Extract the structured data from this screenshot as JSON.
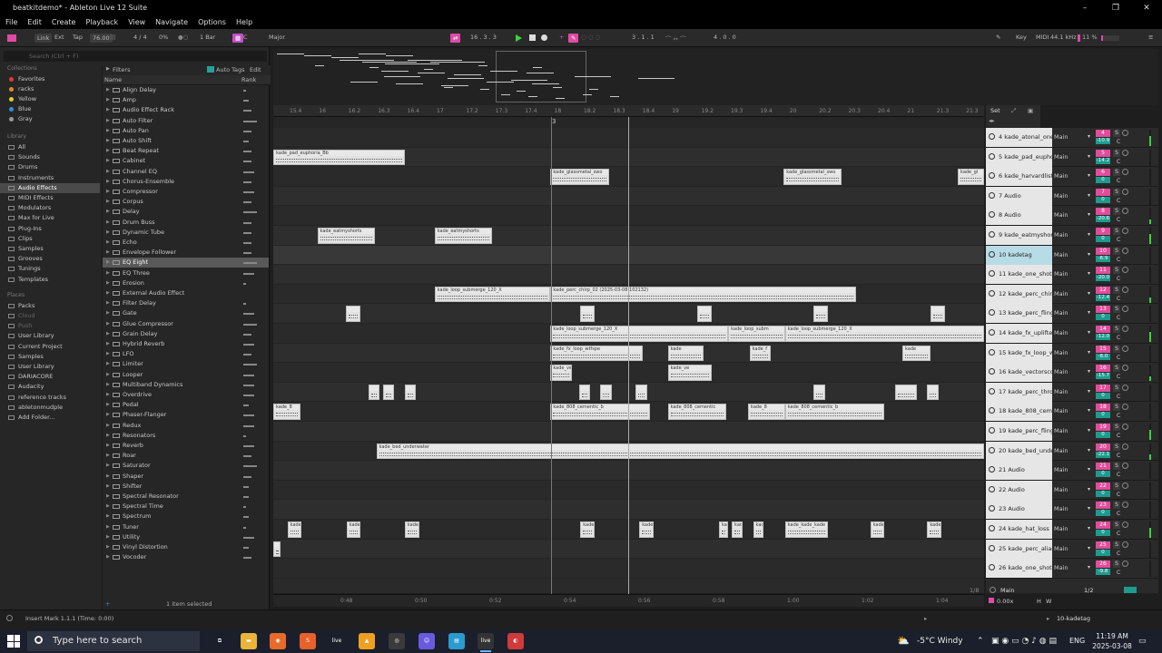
{
  "window": {
    "title": "beatkitdemo* - Ableton Live 12 Suite",
    "controls": [
      "–",
      "❐",
      "✕"
    ]
  },
  "menu": [
    "File",
    "Edit",
    "Create",
    "Playback",
    "View",
    "Navigate",
    "Options",
    "Help"
  ],
  "control_bar": {
    "link": "Link",
    "ext": "Ext",
    "tap": "Tap",
    "tempo": "76.00",
    "time_sig": "4 / 4",
    "swing": "0%",
    "quantize": "1 Bar",
    "key": "C",
    "scale": "Major",
    "position": "16 .   3 .   3",
    "loop_start": "3 .   1 .   1",
    "loop_length": "4 .   0 .   0",
    "key_map": "Key",
    "midi_map": "MIDI",
    "sample_rate": "44.1 kHz",
    "cpu": "11 %",
    "cpu_fraction": 0.11
  },
  "browser": {
    "search_placeholder": "Search (Ctrl + F)",
    "collections_label": "Collections",
    "collections": [
      {
        "label": "Favorites",
        "color": "#e03a3a"
      },
      {
        "label": "racks",
        "color": "#e08a2a"
      },
      {
        "label": "Yellow",
        "color": "#e0d02a"
      },
      {
        "label": "Blue",
        "color": "#3a8ae0"
      },
      {
        "label": "Gray",
        "color": "#9a9a9a"
      }
    ],
    "library_label": "Library",
    "library": [
      "All",
      "Sounds",
      "Drums",
      "Instruments",
      "Audio Effects",
      "MIDI Effects",
      "Modulators",
      "Max for Live",
      "Plug-Ins",
      "Clips",
      "Samples",
      "Grooves",
      "Tunings",
      "Templates"
    ],
    "library_selected": "Audio Effects",
    "places_label": "Places",
    "places": [
      "Packs",
      "Cloud",
      "Push",
      "User Library",
      "Current Project",
      "Samples",
      "User Library",
      "DARIACORE",
      "Audacity",
      "reference tracks",
      "abletonmudple",
      "Add Folder..."
    ],
    "filters": "Filters",
    "auto_tags": "Auto Tags",
    "edit": "Edit",
    "col_name": "Name",
    "col_rank": "Rank",
    "items": [
      "Align Delay",
      "Amp",
      "Audio Effect Rack",
      "Auto Filter",
      "Auto Pan",
      "Auto Shift",
      "Beat Repeat",
      "Cabinet",
      "Channel EQ",
      "Chorus-Ensemble",
      "Compressor",
      "Corpus",
      "Delay",
      "Drum Buss",
      "Dynamic Tube",
      "Echo",
      "Envelope Follower",
      "EQ Eight",
      "EQ Three",
      "Erosion",
      "External Audio Effect",
      "Filter Delay",
      "Gate",
      "Glue Compressor",
      "Grain Delay",
      "Hybrid Reverb",
      "LFO",
      "Limiter",
      "Looper",
      "Multiband Dynamics",
      "Overdrive",
      "Pedal",
      "Phaser-Flanger",
      "Redux",
      "Resonators",
      "Reverb",
      "Roar",
      "Saturator",
      "Shaper",
      "Shifter",
      "Spectral Resonator",
      "Spectral Time",
      "Spectrum",
      "Tuner",
      "Utility",
      "Vinyl Distortion",
      "Vocoder"
    ],
    "ranks": [
      1,
      2,
      3,
      5,
      3,
      2,
      3,
      3,
      4,
      3,
      4,
      3,
      5,
      3,
      3,
      3,
      3,
      5,
      4,
      1,
      0,
      1,
      4,
      5,
      3,
      4,
      3,
      5,
      4,
      4,
      4,
      2,
      4,
      4,
      1,
      4,
      3,
      5,
      3,
      2,
      2,
      1,
      2,
      1,
      4,
      2,
      3
    ],
    "selected_item": "EQ Eight",
    "footer": "1 item selected"
  },
  "ruler_ticks": [
    "15.4",
    "16",
    "16.2",
    "16.3",
    "16.4",
    "17",
    "17.2",
    "17.3",
    "17.4",
    "18",
    "18.2",
    "18.3",
    "18.4",
    "19",
    "19.2",
    "19.3",
    "19.4",
    "20",
    "20.2",
    "20.3",
    "20.4",
    "21",
    "21.3",
    "21.3"
  ],
  "bottom_ticks": [
    "0:48",
    "0:50",
    "0:52",
    "0:54",
    "0:56",
    "0:58",
    "1:00",
    "1:02",
    "1:04"
  ],
  "set_label": "Set",
  "loop_marker": "3",
  "tracks": [
    {
      "name": "4 kade_atonal_one",
      "num": "4",
      "vol": "-10.9"
    },
    {
      "name": "5 kade_pad_euphor",
      "num": "5",
      "vol": "-14.2"
    },
    {
      "name": "6 kade_harvardlist",
      "num": "6",
      "vol": "0"
    },
    {
      "name": "7 Audio",
      "num": "7",
      "vol": "0"
    },
    {
      "name": "8 Audio",
      "num": "8",
      "vol": "-20.6"
    },
    {
      "name": "9 kade_eatmyshort",
      "num": "9",
      "vol": "0"
    },
    {
      "name": "10 kadetag",
      "num": "10",
      "vol": "-6.9"
    },
    {
      "name": "11 kade_one_shot",
      "num": "11",
      "vol": "-20.0"
    },
    {
      "name": "12 kade_perc_chirp",
      "num": "12",
      "vol": "-12.4"
    },
    {
      "name": "13 kade_perc_fling",
      "num": "13",
      "vol": "0"
    },
    {
      "name": "14 kade_fx_uplifter",
      "num": "14",
      "vol": "-12.0"
    },
    {
      "name": "15 kade_fx_loop_w",
      "num": "15",
      "vol": "-6.0"
    },
    {
      "name": "16 kade_vectorsco",
      "num": "16",
      "vol": "-15.7"
    },
    {
      "name": "17 kade_perc_thro",
      "num": "17",
      "vol": "0"
    },
    {
      "name": "18 kade_808_cema",
      "num": "18",
      "vol": "0"
    },
    {
      "name": "19 kade_perc_fling",
      "num": "19",
      "vol": "0"
    },
    {
      "name": "20 kade_bed_under",
      "num": "20",
      "vol": "-22.1"
    },
    {
      "name": "21 Audio",
      "num": "21",
      "vol": "0"
    },
    {
      "name": "22 Audio",
      "num": "22",
      "vol": "0"
    },
    {
      "name": "23 Audio",
      "num": "23",
      "vol": "0"
    },
    {
      "name": "24 kade_hat_loss",
      "num": "24",
      "vol": "0"
    },
    {
      "name": "25 kade_perc_alias",
      "num": "25",
      "vol": "0"
    },
    {
      "name": "26 kade_one_shot",
      "num": "26",
      "vol": "-9.8"
    }
  ],
  "selected_track": "10 kadetag",
  "route_label": "Main",
  "clips": [
    {
      "lane": 1,
      "start": 0.0,
      "end": 0.185,
      "label": "kade_pad_euphoria_Bb"
    },
    {
      "lane": 2,
      "start": 0.39,
      "end": 0.473,
      "label": "kade_glassmetal_swo"
    },
    {
      "lane": 2,
      "start": 0.718,
      "end": 0.8,
      "label": "kade_glassmetal_swo"
    },
    {
      "lane": 2,
      "start": 0.963,
      "end": 1.0,
      "label": "kade_gl"
    },
    {
      "lane": 5,
      "start": 0.062,
      "end": 0.143,
      "label": "kade_eatmyshorts"
    },
    {
      "lane": 5,
      "start": 0.227,
      "end": 0.308,
      "label": "kade_eatmyshorts"
    },
    {
      "lane": 8,
      "start": 0.227,
      "end": 0.39,
      "label": "kade_loop_submerge_120_X"
    },
    {
      "lane": 8,
      "start": 0.39,
      "end": 0.82,
      "label": "kade_perc_chirp_02 (2025-03-08 102132)"
    },
    {
      "lane": 9,
      "start": 0.102,
      "end": 0.122,
      "label": ""
    },
    {
      "lane": 9,
      "start": 0.432,
      "end": 0.452,
      "label": ""
    },
    {
      "lane": 9,
      "start": 0.596,
      "end": 0.617,
      "label": ""
    },
    {
      "lane": 9,
      "start": 0.76,
      "end": 0.78,
      "label": ""
    },
    {
      "lane": 9,
      "start": 0.925,
      "end": 0.945,
      "label": ""
    },
    {
      "lane": 10,
      "start": 0.39,
      "end": 0.64,
      "label": "kade_loop_submerge_120_X"
    },
    {
      "lane": 10,
      "start": 0.64,
      "end": 0.72,
      "label": "kade_loop_subm"
    },
    {
      "lane": 10,
      "start": 0.72,
      "end": 1.0,
      "label": "kade_loop_submerge_120_X"
    },
    {
      "lane": 11,
      "start": 0.39,
      "end": 0.52,
      "label": "kade_fx_loop_wtfspe"
    },
    {
      "lane": 11,
      "start": 0.555,
      "end": 0.605,
      "label": "kade"
    },
    {
      "lane": 11,
      "start": 0.67,
      "end": 0.7,
      "label": "kade_f"
    },
    {
      "lane": 11,
      "start": 0.885,
      "end": 0.925,
      "label": "kade"
    },
    {
      "lane": 12,
      "start": 0.39,
      "end": 0.42,
      "label": "kade_ve"
    },
    {
      "lane": 12,
      "start": 0.555,
      "end": 0.617,
      "label": "kade_ve"
    },
    {
      "lane": 13,
      "start": 0.134,
      "end": 0.15,
      "label": ""
    },
    {
      "lane": 13,
      "start": 0.155,
      "end": 0.17,
      "label": ""
    },
    {
      "lane": 13,
      "start": 0.185,
      "end": 0.2,
      "label": ""
    },
    {
      "lane": 13,
      "start": 0.43,
      "end": 0.446,
      "label": ""
    },
    {
      "lane": 13,
      "start": 0.46,
      "end": 0.476,
      "label": ""
    },
    {
      "lane": 13,
      "start": 0.51,
      "end": 0.526,
      "label": ""
    },
    {
      "lane": 13,
      "start": 0.76,
      "end": 0.776,
      "label": ""
    },
    {
      "lane": 13,
      "start": 0.875,
      "end": 0.905,
      "label": ""
    },
    {
      "lane": 13,
      "start": 0.92,
      "end": 0.936,
      "label": ""
    },
    {
      "lane": 14,
      "start": 0.0,
      "end": 0.038,
      "label": "kade_8"
    },
    {
      "lane": 14,
      "start": 0.39,
      "end": 0.53,
      "label": "kade_808_cementic_b"
    },
    {
      "lane": 14,
      "start": 0.555,
      "end": 0.637,
      "label": "kade_808_cementic"
    },
    {
      "lane": 14,
      "start": 0.668,
      "end": 0.72,
      "label": "kade_8"
    },
    {
      "lane": 14,
      "start": 0.72,
      "end": 0.86,
      "label": "kade_808_cementic_b"
    },
    {
      "lane": 16,
      "start": 0.145,
      "end": 1.0,
      "label": "kade_bed_underwater"
    },
    {
      "lane": 20,
      "start": 0.02,
      "end": 0.04,
      "label": "kade"
    },
    {
      "lane": 20,
      "start": 0.103,
      "end": 0.123,
      "label": "kade"
    },
    {
      "lane": 20,
      "start": 0.185,
      "end": 0.205,
      "label": "kade"
    },
    {
      "lane": 20,
      "start": 0.432,
      "end": 0.452,
      "label": "kade"
    },
    {
      "lane": 20,
      "start": 0.515,
      "end": 0.535,
      "label": "kade"
    },
    {
      "lane": 20,
      "start": 0.627,
      "end": 0.64,
      "label": "kade"
    },
    {
      "lane": 20,
      "start": 0.645,
      "end": 0.66,
      "label": "kade"
    },
    {
      "lane": 20,
      "start": 0.675,
      "end": 0.69,
      "label": "kade"
    },
    {
      "lane": 20,
      "start": 0.72,
      "end": 0.78,
      "label": "kade_kade_kade"
    },
    {
      "lane": 20,
      "start": 0.84,
      "end": 0.86,
      "label": "kade"
    },
    {
      "lane": 20,
      "start": 0.92,
      "end": 0.94,
      "label": "kade"
    },
    {
      "lane": 21,
      "start": 0.0,
      "end": 0.01,
      "label": ""
    }
  ],
  "master": {
    "label": "Main",
    "fraction": "1/8",
    "route": "1/2"
  },
  "status": {
    "message": "Insert Mark 1.1.1 (Time: 0:00)",
    "track": "10-kadetag",
    "zoom": "0.00x"
  },
  "taskbar": {
    "search_placeholder": "Type here to search",
    "weather": "-5°C  Windy",
    "lang": "ENG",
    "time": "11:19 AM",
    "date": "2025-03-08",
    "apps": [
      {
        "name": "task-view-icon",
        "color": "#1a1f2b",
        "label": "⧉"
      },
      {
        "name": "file-explorer-icon",
        "color": "#e8b53a",
        "label": "▬"
      },
      {
        "name": "firefox-icon",
        "color": "#e86a2a",
        "label": "◉"
      },
      {
        "name": "sublime-icon",
        "color": "#e8602a",
        "label": "S"
      },
      {
        "name": "ableton-live-icon",
        "color": "#1a1f2b",
        "label": "live"
      },
      {
        "name": "fl-studio-icon",
        "color": "#f0a020",
        "label": "▲"
      },
      {
        "name": "obs-icon",
        "color": "#3a3a3a",
        "label": "◎"
      },
      {
        "name": "discord-icon",
        "color": "#6a5ae0",
        "label": "☺"
      },
      {
        "name": "notepad-icon",
        "color": "#2a9ad0",
        "label": "▤"
      },
      {
        "name": "ableton-active-icon",
        "color": "#333",
        "label": "live"
      },
      {
        "name": "chrome-icon",
        "color": "#d03a3a",
        "label": "◐"
      }
    ]
  }
}
